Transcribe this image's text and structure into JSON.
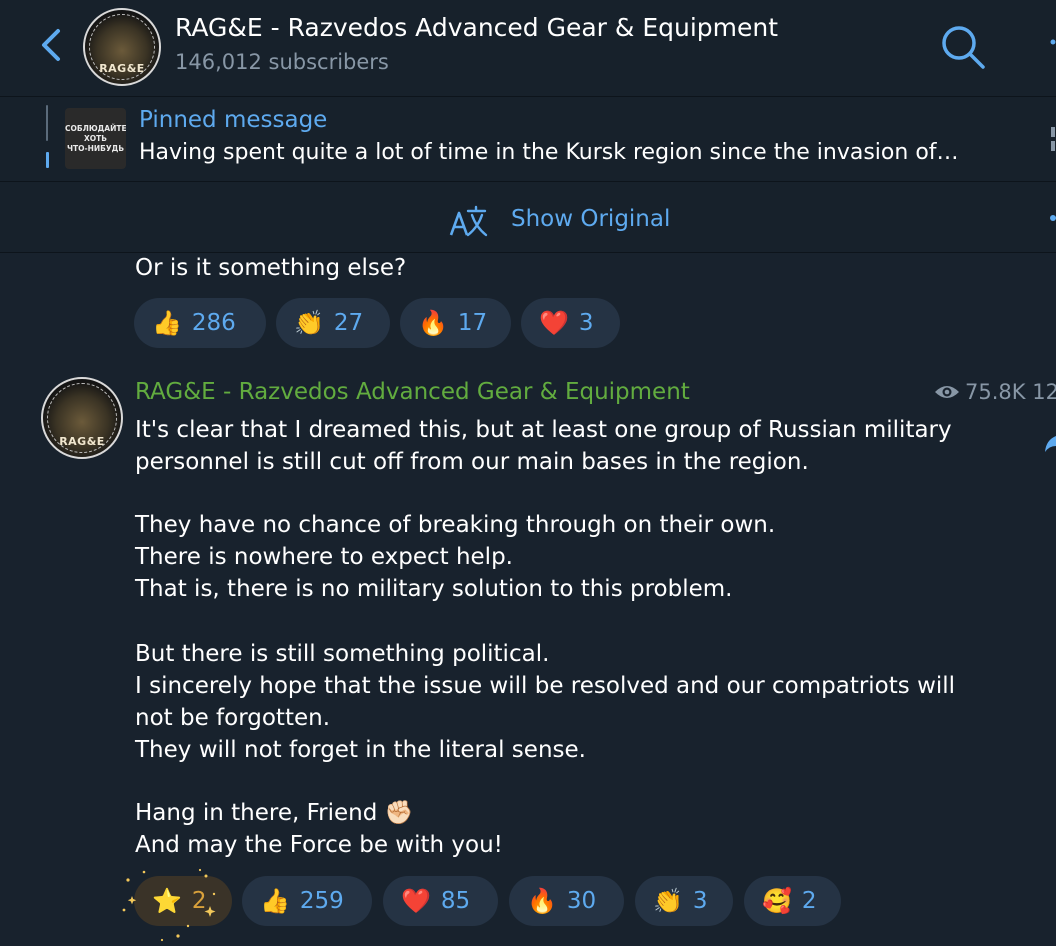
{
  "header": {
    "title": "RAG&E - Razvedos Advanced Gear & Equipment",
    "subscribers": "146,012 subscribers",
    "avatar_tag": "RAG&E"
  },
  "pinned": {
    "label": "Pinned message",
    "text": "Having spent quite a lot of time in the Kursk region since the invasion of…",
    "thumb_lines": [
      "СОБЛЮДАЙТЕ",
      "ХОТЬ",
      "ЧТО-НИБУДЬ"
    ]
  },
  "translate_bar": {
    "label": "Show Original"
  },
  "prev_message": {
    "last_line": "Or is it something else?",
    "reactions": [
      {
        "emoji": "👍",
        "count": "286"
      },
      {
        "emoji": "👏",
        "count": "27"
      },
      {
        "emoji": "🔥",
        "count": "17"
      },
      {
        "emoji": "❤️",
        "count": "3"
      }
    ]
  },
  "message": {
    "author": "RAG&E - Razvedos Advanced Gear & Equipment",
    "views": "75.8K 12",
    "lines": [
      "It's clear that I dreamed this, but at least one group of Russian military",
      "personnel is still cut off from our main bases in the region.",
      "They have no chance of breaking through on their own.",
      "There is nowhere to expect help.",
      "That is, there is no military solution to this problem.",
      "But there is still something political.",
      "I sincerely hope that the issue will be resolved and our compatriots will",
      "not be forgotten.",
      "They will not forget in the literal sense.",
      "Hang in there, Friend ✊🏻",
      "And may the Force be with you!"
    ],
    "reactions": [
      {
        "emoji": "⭐",
        "count": "2"
      },
      {
        "emoji": "👍",
        "count": "259"
      },
      {
        "emoji": "❤️",
        "count": "85"
      },
      {
        "emoji": "🔥",
        "count": "30"
      },
      {
        "emoji": "👏",
        "count": "3"
      },
      {
        "emoji": "🥰",
        "count": "2"
      }
    ]
  },
  "colors": {
    "background": "#18222d",
    "accent": "#5eaaef",
    "author": "#62ac3f",
    "reaction_bg": "#253344",
    "muted": "#8897a6"
  }
}
